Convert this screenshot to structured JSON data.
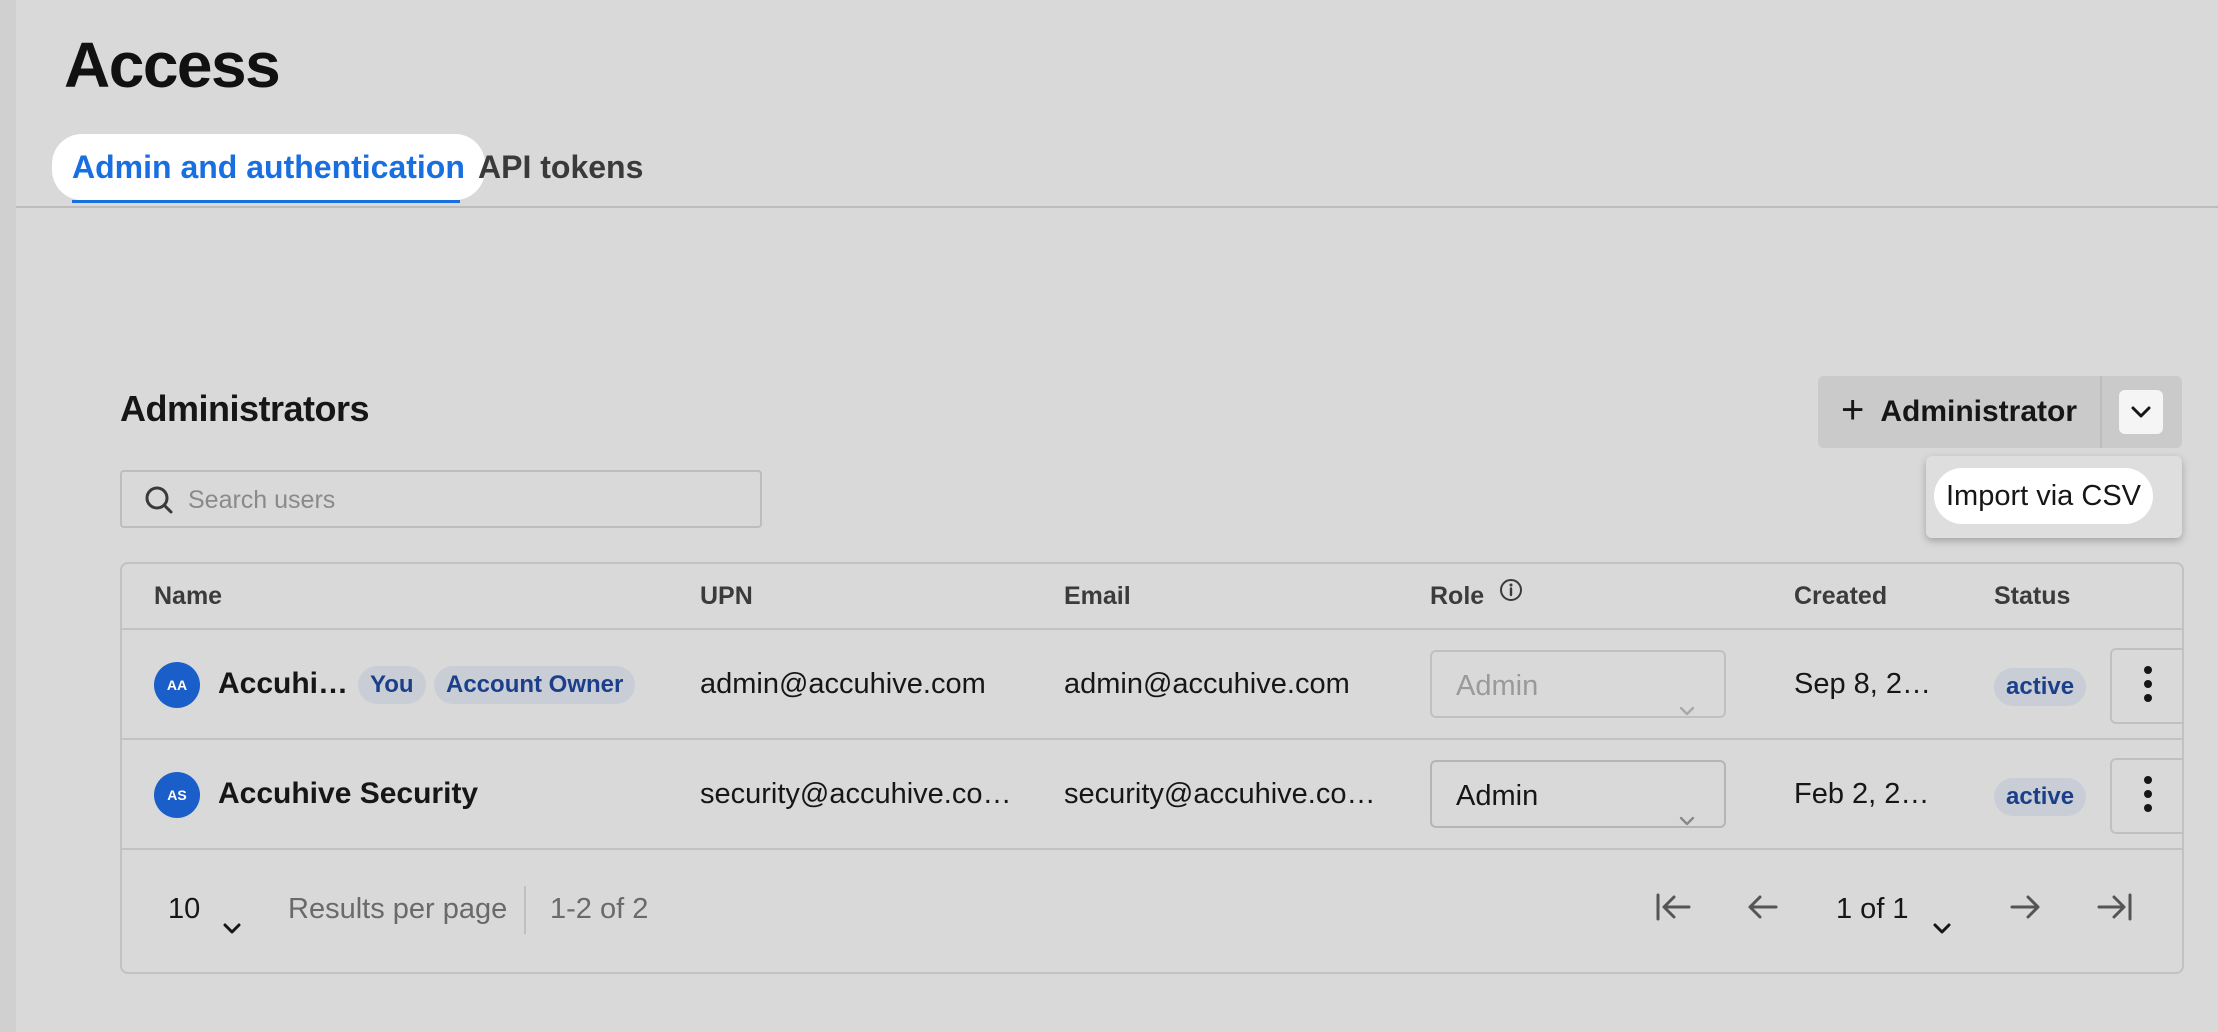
{
  "page": {
    "title": "Access"
  },
  "tabs": [
    {
      "label": "Admin and authentication",
      "active": true
    },
    {
      "label": "API tokens",
      "active": false
    }
  ],
  "administrators": {
    "title": "Administrators",
    "add_button_label": "Administrator",
    "dropdown_items": [
      "Import via CSV"
    ],
    "search": {
      "placeholder": "Search users",
      "value": ""
    },
    "columns": [
      "Name",
      "UPN",
      "Email",
      "Role",
      "Created",
      "Status"
    ],
    "rows": [
      {
        "initials": "AA",
        "name": "Accuhi…",
        "badges": [
          "You",
          "Account Owner"
        ],
        "upn": "admin@accuhive.com",
        "email": "admin@accuhive.com",
        "role": "Admin",
        "role_disabled": true,
        "created": "Sep 8, 2…",
        "status": "active"
      },
      {
        "initials": "AS",
        "name": "Accuhive Security",
        "badges": [],
        "upn": "security@accuhive.co…",
        "email": "security@accuhive.co…",
        "role": "Admin",
        "role_disabled": false,
        "created": "Feb 2, 2…",
        "status": "active"
      }
    ],
    "pagination": {
      "per_page": "10",
      "per_page_label": "Results per page",
      "range": "1-2 of 2",
      "page": "1 of 1"
    }
  },
  "colors": {
    "accent": "#1a6fe0",
    "background": "#d9d9d9",
    "badge_bg": "#c8cdd6",
    "badge_text": "#1b3f8a",
    "avatar": "#1a5ec9"
  },
  "icons": {
    "add": "plus-icon",
    "split": "chevron-down-icon",
    "search": "search-icon",
    "role_info": "info-icon",
    "row_menu": "kebab-icon",
    "first": "first-page-icon",
    "prev": "arrow-left-icon",
    "next": "arrow-right-icon",
    "last": "last-page-icon"
  }
}
